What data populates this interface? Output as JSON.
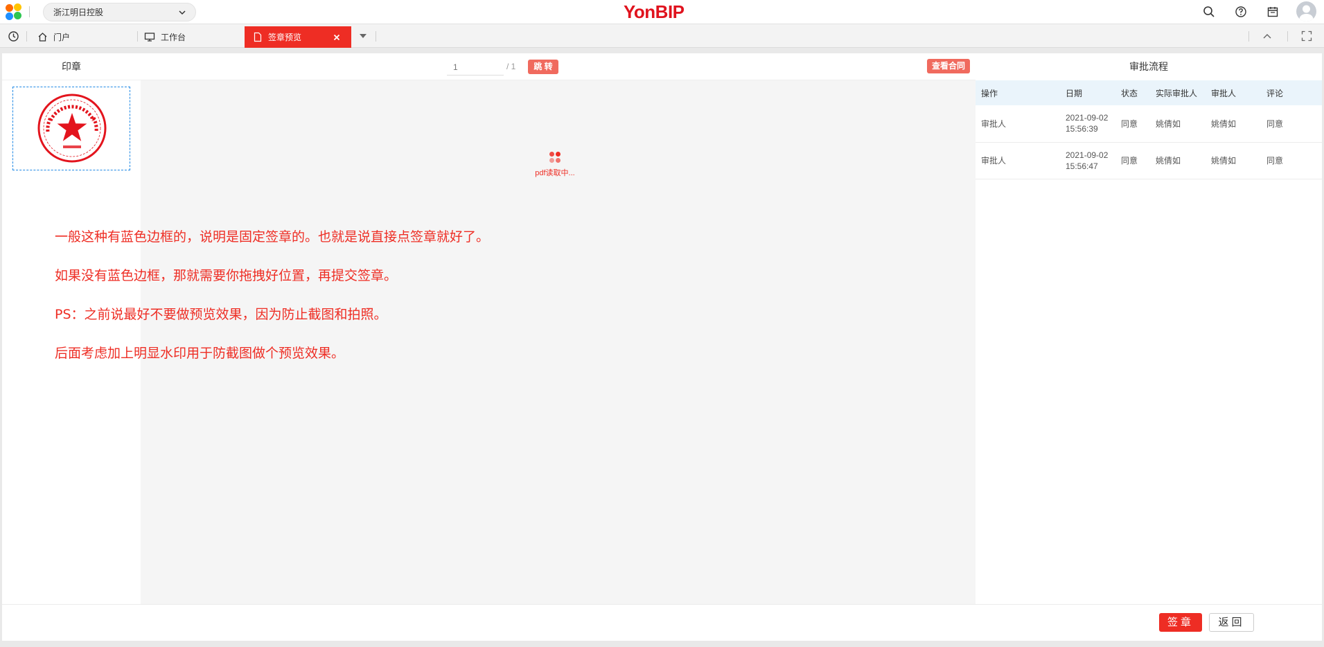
{
  "header": {
    "org_name": "浙江明日控股",
    "brand": "YonBIP",
    "icons": [
      "search-icon",
      "help-icon",
      "calendar-icon",
      "avatar"
    ]
  },
  "tabs": [
    {
      "label": "门户",
      "icon": "home-icon",
      "active": false
    },
    {
      "label": "工作台",
      "icon": "monitor-icon",
      "active": false
    },
    {
      "label": "签章预览",
      "icon": "document-icon",
      "active": true
    }
  ],
  "seal_panel": {
    "title": "印章"
  },
  "viewer": {
    "page_input_placeholder": "1",
    "page_total": "/ 1",
    "jump_label": "跳 转",
    "view_contract_label": "查看合同",
    "loading_text": "pdf读取中..."
  },
  "notes": [
    "一般这种有蓝色边框的，说明是固定签章的。也就是说直接点签章就好了。",
    "如果没有蓝色边框，那就需要你拖拽好位置，再提交签章。",
    "PS：之前说最好不要做预览效果，因为防止截图和拍照。",
    "后面考虑加上明显水印用于防截图做个预览效果。"
  ],
  "approval": {
    "title": "审批流程",
    "columns": [
      "操作",
      "日期",
      "状态",
      "实际审批人",
      "审批人",
      "评论"
    ],
    "rows": [
      {
        "action": "审批人",
        "date": "2021-09-02",
        "time": "15:56:39",
        "status": "同意",
        "actual_approver": "姚倩如",
        "approver": "姚倩如",
        "comment": "同意"
      },
      {
        "action": "审批人",
        "date": "2021-09-02",
        "time": "15:56:47",
        "status": "同意",
        "actual_approver": "姚倩如",
        "approver": "姚倩如",
        "comment": "同意"
      }
    ]
  },
  "footer": {
    "sign_label": "签章",
    "back_label": "返回"
  },
  "colors": {
    "accent": "#ee2d24",
    "brand_red": "#e0131e",
    "seal_border": "#1e88e5",
    "table_header": "#eaf4fb"
  }
}
